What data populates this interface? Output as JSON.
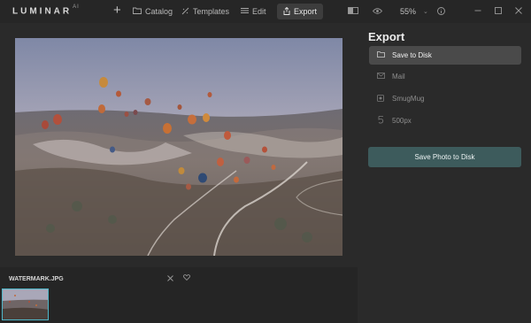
{
  "app": {
    "logo": "LUMINAR",
    "logo_suffix": "AI"
  },
  "topbar": {
    "add_icon": "plus-icon",
    "catalog_label": "Catalog",
    "templates_label": "Templates",
    "edit_label": "Edit",
    "export_label": "Export",
    "zoom_value": "55%"
  },
  "export_panel": {
    "title": "Export",
    "options": [
      {
        "label": "Save to Disk",
        "icon": "folder-icon",
        "selected": true
      },
      {
        "label": "Mail",
        "icon": "mail-icon",
        "selected": false
      },
      {
        "label": "SmugMug",
        "icon": "smugmug-icon",
        "selected": false
      },
      {
        "label": "500px",
        "icon": "500px-icon",
        "selected": false
      }
    ],
    "save_button_label": "Save Photo to Disk"
  },
  "filmstrip": {
    "filename": "WATERMARK.JPG"
  },
  "colors": {
    "accent_teal": "#3d5b5c",
    "thumbnail_border": "#4fb6c8",
    "selected_option_bg": "#4a4a4a"
  }
}
